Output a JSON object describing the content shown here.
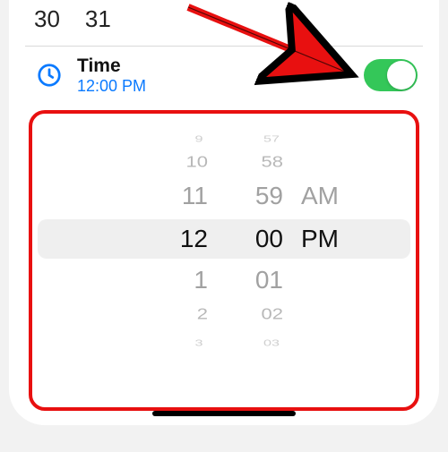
{
  "calendar": {
    "days": [
      "30",
      "31"
    ]
  },
  "timeRow": {
    "title": "Time",
    "value": "12:00 PM",
    "toggleOn": true
  },
  "picker": {
    "hours": {
      "above": [
        "9",
        "10",
        "11"
      ],
      "selected": "12",
      "below": [
        "1",
        "2",
        "3"
      ]
    },
    "minutes": {
      "above": [
        "57",
        "58",
        "59"
      ],
      "selected": "00",
      "below": [
        "01",
        "02",
        "03"
      ]
    },
    "ampm": {
      "above": [
        "",
        "",
        "AM"
      ],
      "selected": "PM",
      "below": [
        "",
        "",
        ""
      ]
    }
  },
  "colors": {
    "accent": "#0a7aff",
    "switchOn": "#34c759",
    "annotation": "#e81010"
  }
}
